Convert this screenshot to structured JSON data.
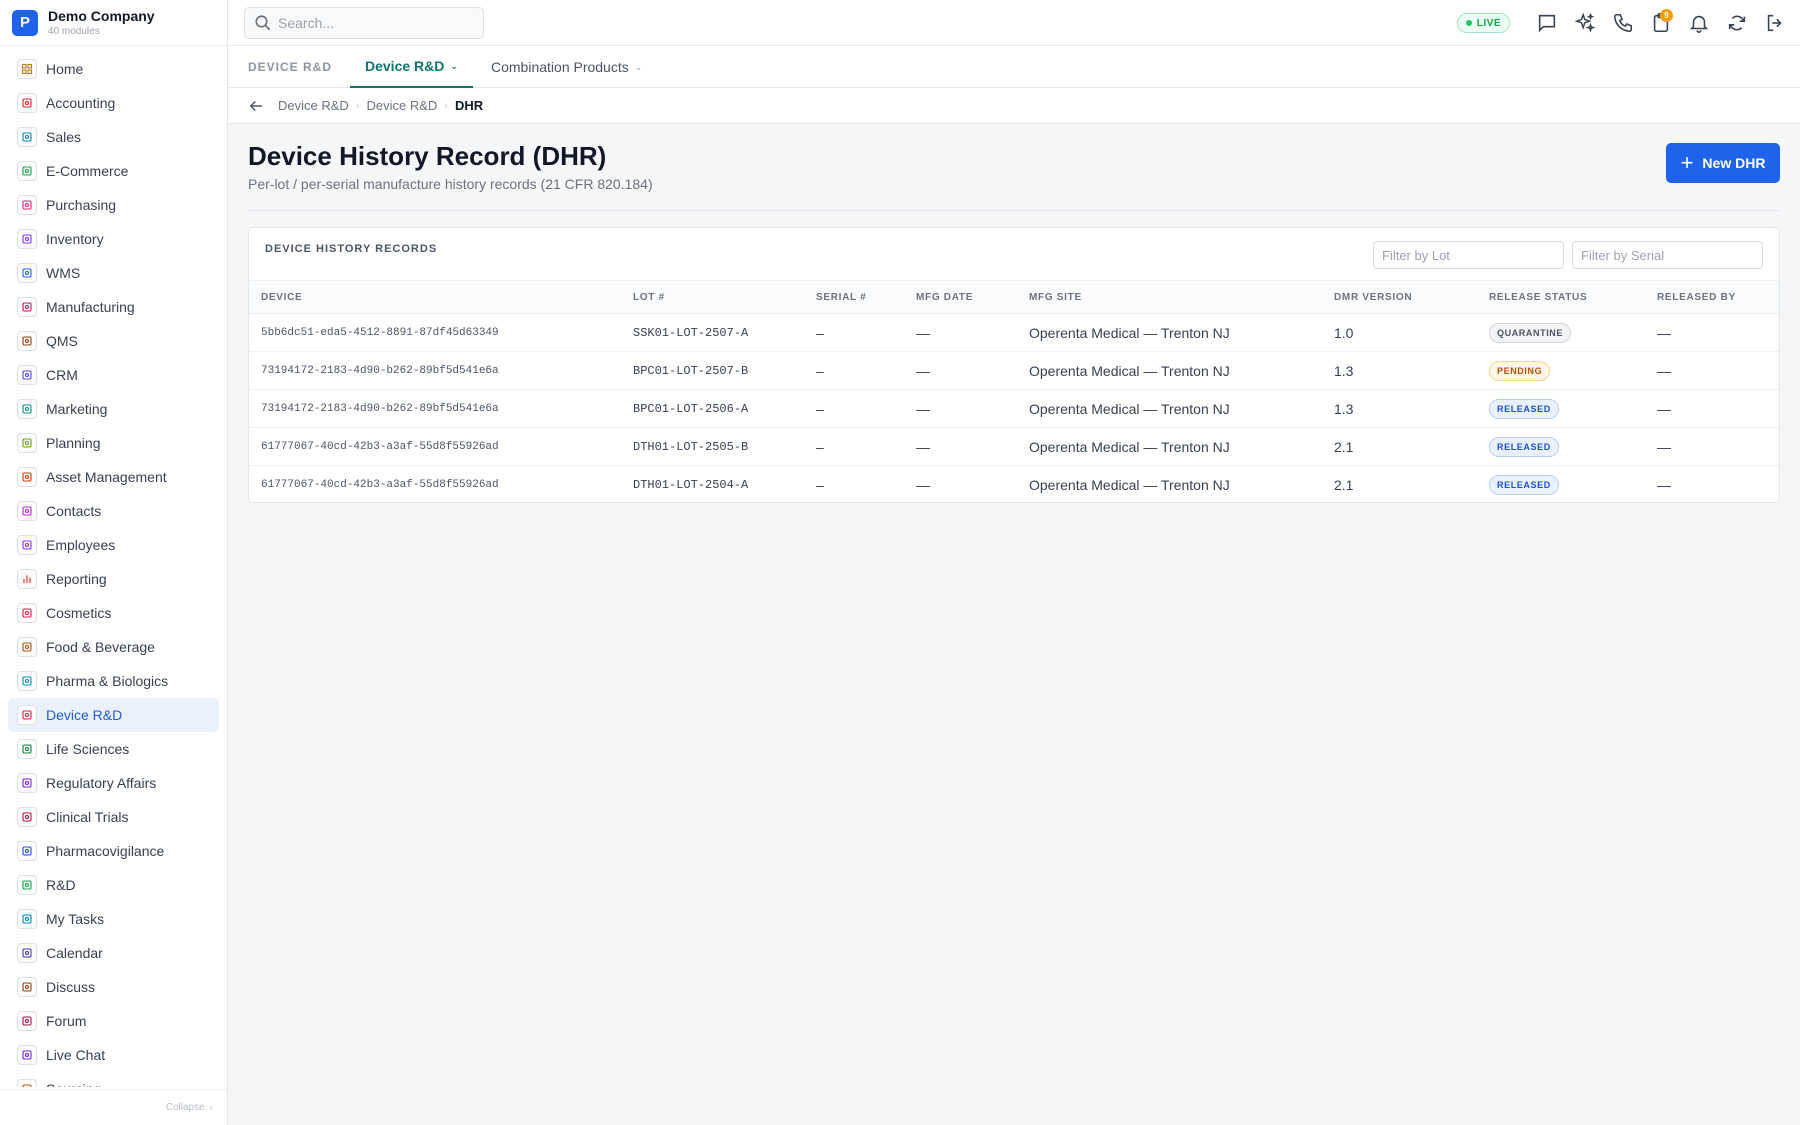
{
  "brand": {
    "logo_letter": "P",
    "name": "Demo Company",
    "subtitle": "40 modules"
  },
  "sidebar": {
    "items": [
      {
        "label": "Home",
        "icon": "grid-icon",
        "color": "#b7791f"
      },
      {
        "label": "Accounting",
        "icon": "bank-icon",
        "color": "#dc2626"
      },
      {
        "label": "Sales",
        "icon": "user-icon",
        "color": "#0284c7"
      },
      {
        "label": "E-Commerce",
        "icon": "store-icon",
        "color": "#16a34a"
      },
      {
        "label": "Purchasing",
        "icon": "cart-icon",
        "color": "#db2777"
      },
      {
        "label": "Inventory",
        "icon": "box-icon",
        "color": "#7c3aed"
      },
      {
        "label": "WMS",
        "icon": "warehouse-icon",
        "color": "#2563eb"
      },
      {
        "label": "Manufacturing",
        "icon": "factory-icon",
        "color": "#be185d"
      },
      {
        "label": "QMS",
        "icon": "badge-check-icon",
        "color": "#92400e"
      },
      {
        "label": "CRM",
        "icon": "users-icon",
        "color": "#4f46e5"
      },
      {
        "label": "Marketing",
        "icon": "megaphone-icon",
        "color": "#0d9488"
      },
      {
        "label": "Planning",
        "icon": "calendar-grid-icon",
        "color": "#65a30d"
      },
      {
        "label": "Asset Management",
        "icon": "tools-icon",
        "color": "#c2410c"
      },
      {
        "label": "Contacts",
        "icon": "contact-icon",
        "color": "#c026d3"
      },
      {
        "label": "Employees",
        "icon": "id-card-icon",
        "color": "#9333ea"
      },
      {
        "label": "Reporting",
        "icon": "bar-chart-icon",
        "color": "#dc2626"
      },
      {
        "label": "Cosmetics",
        "icon": "flower-icon",
        "color": "#e11d48"
      },
      {
        "label": "Food & Beverage",
        "icon": "utensils-icon",
        "color": "#b45309"
      },
      {
        "label": "Pharma & Biologics",
        "icon": "vial-icon",
        "color": "#0891b2"
      },
      {
        "label": "Device R&D",
        "icon": "cog-icon",
        "color": "#e11d48"
      },
      {
        "label": "Life Sciences",
        "icon": "flask-icon",
        "color": "#15803d"
      },
      {
        "label": "Regulatory Affairs",
        "icon": "gavel-icon",
        "color": "#7e22ce"
      },
      {
        "label": "Clinical Trials",
        "icon": "clipboard-icon",
        "color": "#be123c"
      },
      {
        "label": "Pharmacovigilance",
        "icon": "shield-icon",
        "color": "#1d4ed8"
      },
      {
        "label": "R&D",
        "icon": "beaker-icon",
        "color": "#16a34a"
      },
      {
        "label": "My Tasks",
        "icon": "checklist-icon",
        "color": "#0284c7"
      },
      {
        "label": "Calendar",
        "icon": "calendar-icon",
        "color": "#4338ca"
      },
      {
        "label": "Discuss",
        "icon": "chat-icon",
        "color": "#92400e"
      },
      {
        "label": "Forum",
        "icon": "forum-icon",
        "color": "#9d174d"
      },
      {
        "label": "Live Chat",
        "icon": "headset-icon",
        "color": "#6d28d9"
      },
      {
        "label": "Sourcing",
        "icon": "search-doc-icon",
        "color": "#a16207"
      }
    ],
    "active_index": 19,
    "collapse_label": "Collapse"
  },
  "topbar": {
    "search_placeholder": "Search...",
    "live_label": "LIVE",
    "notification_count": "9"
  },
  "tabs": {
    "section_label": "DEVICE R&D",
    "items": [
      {
        "label": "Device R&D",
        "active": true
      },
      {
        "label": "Combination Products",
        "active": false
      }
    ]
  },
  "breadcrumb": {
    "items": [
      "Device R&D",
      "Device R&D"
    ],
    "current": "DHR"
  },
  "page": {
    "title": "Device History Record (DHR)",
    "subtitle": "Per-lot / per-serial manufacture history records (21 CFR 820.184)",
    "new_button_label": "New DHR"
  },
  "records": {
    "title": "DEVICE HISTORY RECORDS",
    "filter_lot_placeholder": "Filter by Lot",
    "filter_serial_placeholder": "Filter by Serial",
    "columns": [
      "DEVICE",
      "LOT #",
      "SERIAL #",
      "MFG DATE",
      "MFG SITE",
      "DMR VERSION",
      "RELEASE STATUS",
      "RELEASED BY"
    ],
    "rows": [
      {
        "device": "5bb6dc51-eda5-4512-8891-87df45d63349",
        "lot": "SSK01-LOT-2507-A",
        "serial": "–",
        "mfg_date": "—",
        "site": "Operenta Medical — Trenton NJ",
        "dmr": "1.0",
        "status": "QUARANTINE",
        "status_key": "quarantine",
        "released_by": "—"
      },
      {
        "device": "73194172-2183-4d90-b262-89bf5d541e6a",
        "lot": "BPC01-LOT-2507-B",
        "serial": "–",
        "mfg_date": "—",
        "site": "Operenta Medical — Trenton NJ",
        "dmr": "1.3",
        "status": "PENDING",
        "status_key": "pending",
        "released_by": "—"
      },
      {
        "device": "73194172-2183-4d90-b262-89bf5d541e6a",
        "lot": "BPC01-LOT-2506-A",
        "serial": "–",
        "mfg_date": "—",
        "site": "Operenta Medical — Trenton NJ",
        "dmr": "1.3",
        "status": "RELEASED",
        "status_key": "released",
        "released_by": "—"
      },
      {
        "device": "61777067-40cd-42b3-a3af-55d8f55926ad",
        "lot": "DTH01-LOT-2505-B",
        "serial": "–",
        "mfg_date": "—",
        "site": "Operenta Medical — Trenton NJ",
        "dmr": "2.1",
        "status": "RELEASED",
        "status_key": "released",
        "released_by": "—"
      },
      {
        "device": "61777067-40cd-42b3-a3af-55d8f55926ad",
        "lot": "DTH01-LOT-2504-A",
        "serial": "–",
        "mfg_date": "—",
        "site": "Operenta Medical — Trenton NJ",
        "dmr": "2.1",
        "status": "RELEASED",
        "status_key": "released",
        "released_by": "—"
      }
    ]
  },
  "colors": {
    "primary": "#1e63e9",
    "tab_active": "#0f766e",
    "live": "#16a34a",
    "badge_notification": "#f59e0b"
  }
}
